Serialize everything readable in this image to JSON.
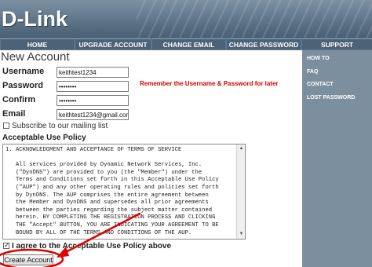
{
  "brand": {
    "logo_text": "D-Link"
  },
  "nav": {
    "tabs": [
      {
        "label": "HOME"
      },
      {
        "label": "UPGRADE ACCOUNT"
      },
      {
        "label": "CHANGE EMAIL"
      },
      {
        "label": "CHANGE PASSWORD"
      },
      {
        "label": "SUPPORT"
      }
    ]
  },
  "sidebar": {
    "items": [
      {
        "label": "HOW TO"
      },
      {
        "label": "FAQ"
      },
      {
        "label": "CONTACT"
      },
      {
        "label": "LOST PASSWORD"
      }
    ]
  },
  "page": {
    "title": "New Account"
  },
  "form": {
    "username": {
      "label": "Username",
      "value": "keithtest1234"
    },
    "password": {
      "label": "Password",
      "value": "••••••••"
    },
    "confirm": {
      "label": "Confirm",
      "value": "••••••••"
    },
    "email": {
      "label": "Email",
      "value": "keithtest1234@gmail.com"
    },
    "subscribe": {
      "label": "Subscribe to our mailing list",
      "checked": false
    },
    "annotation": "Remember the  Username & Password for later",
    "aup_heading": "Acceptable Use Policy",
    "aup_text": "1. ACKNOWLEDGMENT AND ACCEPTANCE OF TERMS OF SERVICE\n\n   All services provided by Dynamic Network Services, Inc.\n   (\"DynDNS\") are provided to you (the \"Member\") under the\n   Terms and Conditions set forth in this Acceptable Use Policy\n   (\"AUP\") and any other operating rules and policies set forth\n   by DynDNS. The AUP comprises the entire agreement between\n   the Member and DynDNS and supersedes all prior agreements\n   between the parties regarding the subject matter contained\n   herein. BY COMPLETING THE REGISTRATION PROCESS AND CLICKING\n   THE \"Accept\" BUTTON, YOU ARE INDICATING YOUR AGREEMENT TO BE\n   BOUND BY ALL OF THE TERMS AND CONDITIONS OF THE AUP.",
    "agree": {
      "label": "I agree to the Acceptable Use Policy above",
      "checked": true
    },
    "submit_label": "Create Account"
  },
  "colors": {
    "annotation_red": "#e00000",
    "header_blue": "#5b7287",
    "sidebar_gray": "#7c8f9f"
  }
}
